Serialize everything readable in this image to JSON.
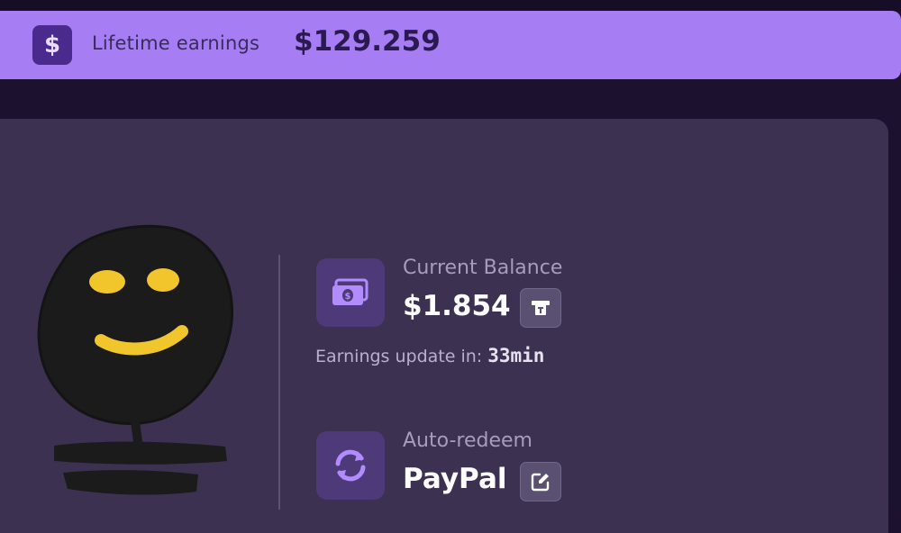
{
  "banner": {
    "icon": "dollar-sign-icon",
    "icon_glyph": "$",
    "label": "Lifetime earnings",
    "value": "$129.259"
  },
  "balance": {
    "icon": "cash-icon",
    "label": "Current Balance",
    "value": "$1.854",
    "action_icon": "atm-withdraw-icon"
  },
  "update": {
    "label": "Earnings update in:",
    "time": "33min"
  },
  "auto_redeem": {
    "icon": "sync-icon",
    "label": "Auto-redeem",
    "value": "PayPal",
    "action_icon": "edit-icon"
  },
  "colors": {
    "banner_bg": "#a67df2",
    "card_bg": "#3d3152",
    "accent": "#b28cff",
    "page_bg": "#1c1230"
  }
}
